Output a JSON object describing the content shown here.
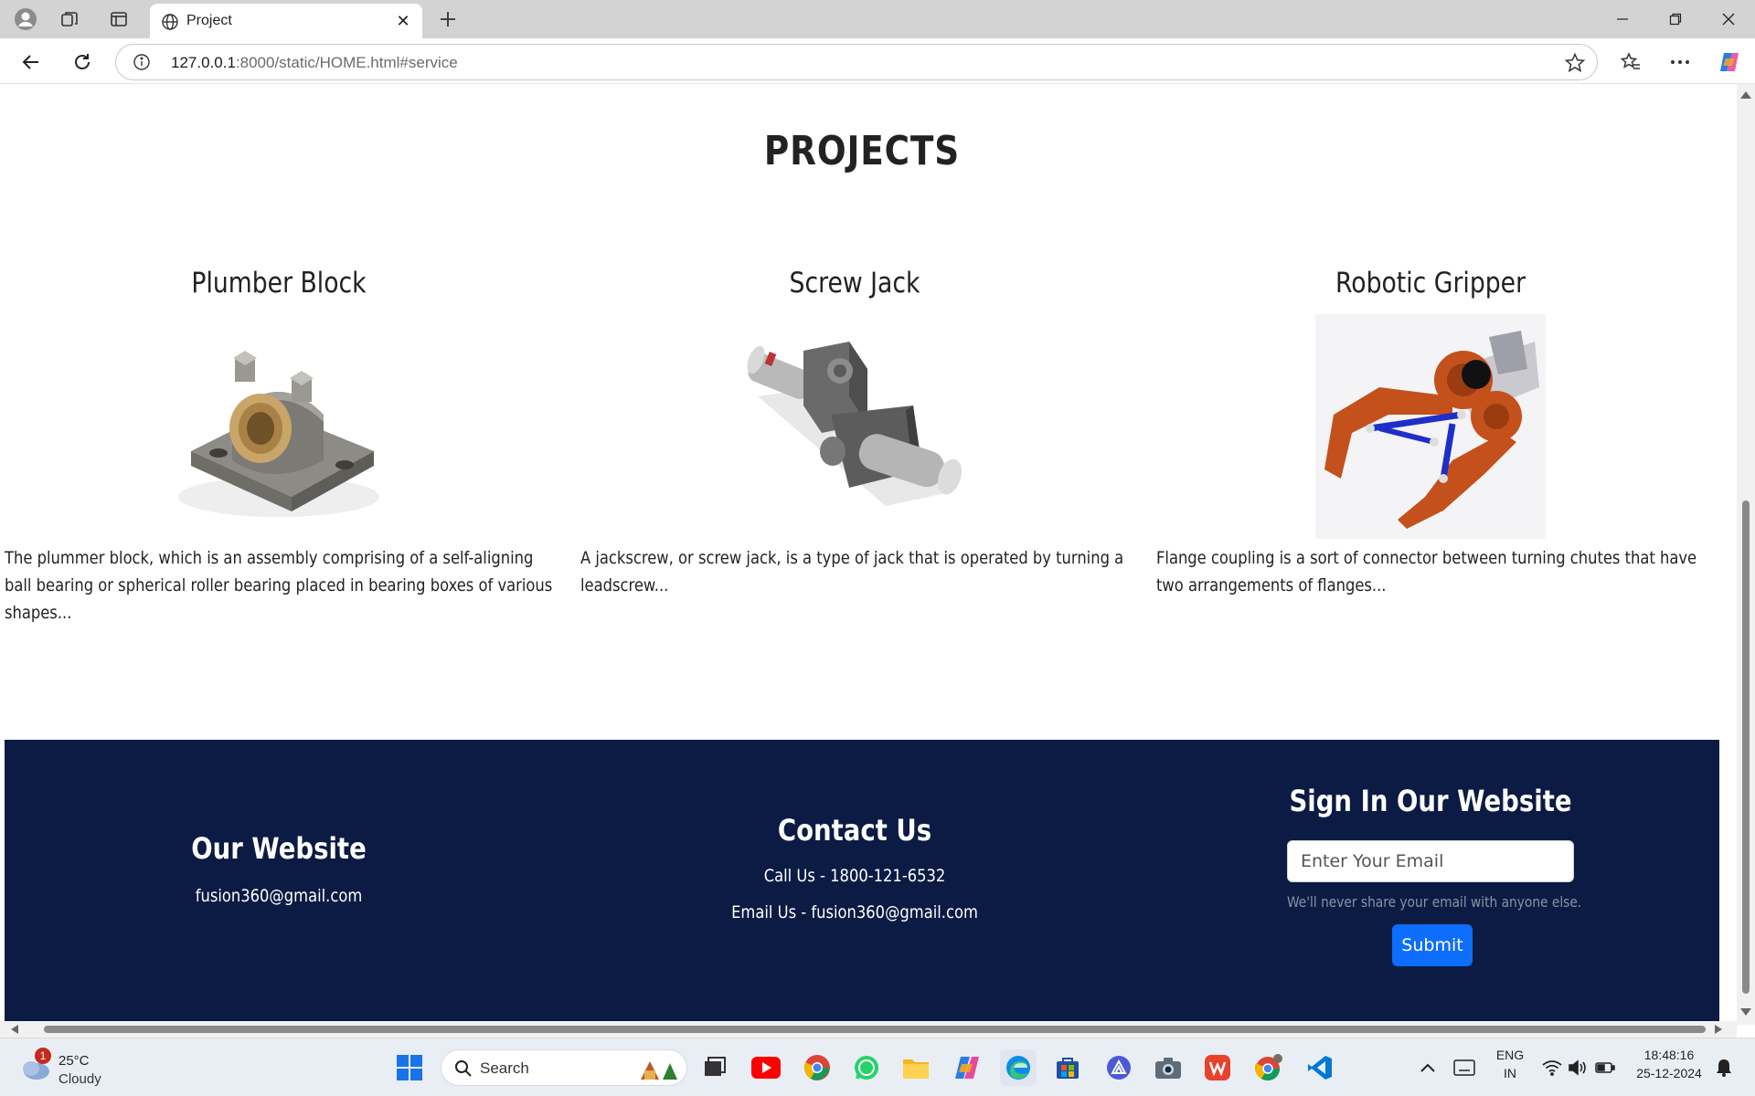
{
  "browser": {
    "tab_title": "Project",
    "url_host": "127.0.0.1",
    "url_rest": ":8000/static/HOME.html#service"
  },
  "projects_section": {
    "title": "PROJECTS",
    "items": [
      {
        "title": "Plumber Block",
        "image_icon": "plummer-block-render",
        "description": "The plummer block, which is an assembly comprising of a self-aligning ball bearing or spherical roller bearing placed in bearing boxes of various shapes..."
      },
      {
        "title": "Screw Jack",
        "image_icon": "screw-jack-render",
        "description": "A jackscrew, or screw jack, is a type of jack that is operated by turning a leadscrew..."
      },
      {
        "title": "Robotic Gripper",
        "image_icon": "robotic-gripper-render",
        "description": "Flange coupling is a sort of connector between turning chutes that have two arrangements of flanges..."
      }
    ]
  },
  "footer": {
    "website": {
      "heading": "Our Website",
      "email": "fusion360@gmail.com"
    },
    "contact": {
      "heading": "Contact Us",
      "phone": "Call Us - 1800-121-6532",
      "email": "Email Us - fusion360@gmail.com"
    },
    "signin": {
      "heading": "Sign In Our Website",
      "email_placeholder": "Enter Your Email",
      "help_text": "We'll never share your email with anyone else.",
      "submit_label": "Submit"
    },
    "background_color": "#0b1b43",
    "button_color": "#0d6efd"
  },
  "taskbar": {
    "weather_badge": "1",
    "temperature": "25°C",
    "condition": "Cloudy",
    "search_label": "Search",
    "language_primary": "ENG",
    "language_secondary": "IN",
    "time": "18:48:16",
    "date": "25-12-2024"
  }
}
